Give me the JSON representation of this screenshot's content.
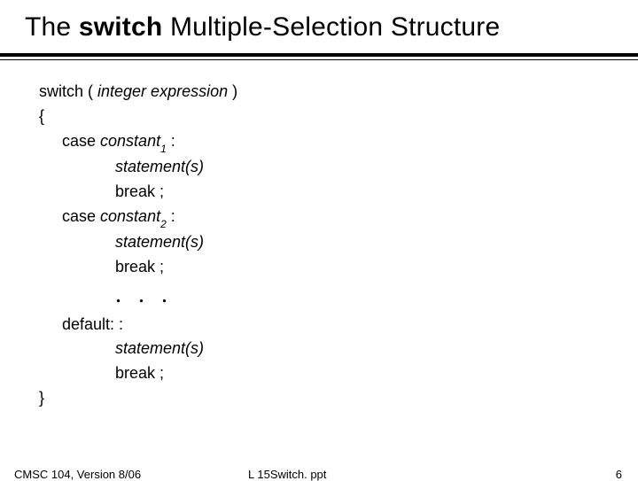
{
  "title": {
    "pre": "The ",
    "bold": "switch",
    "post": " Multiple-Selection Structure"
  },
  "code": {
    "switch_kw": "switch ( ",
    "switch_expr": "integer expression",
    "switch_close": " )",
    "open_brace": "{",
    "case_kw1": "case ",
    "const1": "constant",
    "sub1": "1",
    "colon": " :",
    "stmt": "statement(s)",
    "brk": "break ;",
    "case_kw2": "case ",
    "const2": "constant",
    "sub2": "2",
    "dots": ". . .",
    "default": "default: :",
    "close_brace": "}"
  },
  "footer": {
    "left": "CMSC 104, Version 8/06",
    "center": "L 15Switch. ppt",
    "right": "6"
  }
}
